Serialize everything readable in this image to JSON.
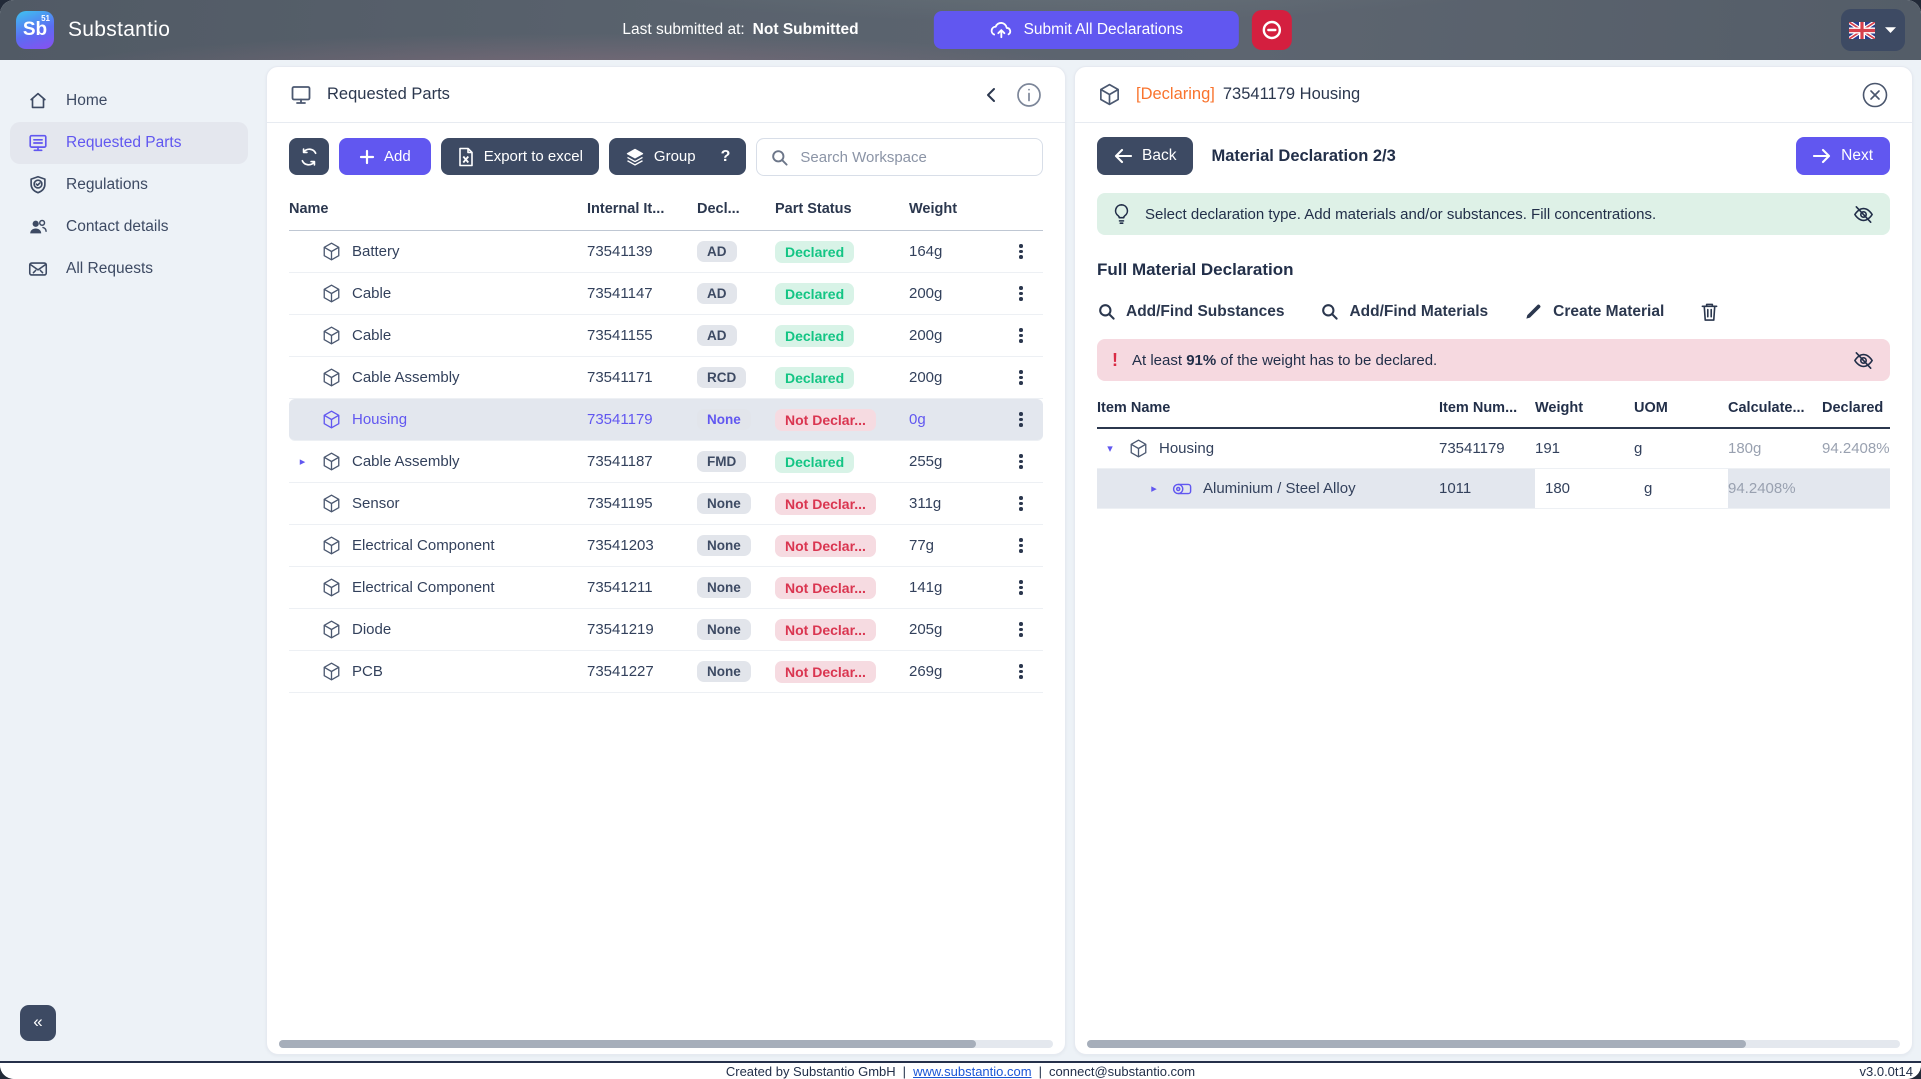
{
  "colors": {
    "accent": "#6157f0",
    "dark_button": "#3d4a63",
    "danger": "#d41f3f",
    "declared_green": "#13c584",
    "not_declared_red": "#da3550",
    "declaring_orange": "#f9742e"
  },
  "icons": [
    "home-icon",
    "monitor-icon",
    "shield-check-icon",
    "users-icon",
    "mail-icon",
    "cube-icon",
    "refresh-icon",
    "plus-icon",
    "excel-file-icon",
    "layers-icon",
    "search-icon",
    "chevron-left-icon",
    "info-icon",
    "kebab-menu-icon",
    "cloud-upload-icon",
    "minus-circle-icon",
    "uk-flag-icon",
    "caret-down-icon",
    "close-circle-icon",
    "arrow-left-icon",
    "arrow-right-icon",
    "bulb-icon",
    "eye-off-icon",
    "pencil-icon",
    "trash-icon",
    "material-icon",
    "collapse-icon"
  ],
  "topbar": {
    "logo_text": "Sb",
    "logo_sup": "51",
    "brand": "Substantio",
    "last_submitted_label": "Last submitted at:",
    "last_submitted_value": "Not Submitted",
    "submit_label": "Submit All Declarations"
  },
  "sidebar": {
    "items": [
      {
        "label": "Home"
      },
      {
        "label": "Requested Parts"
      },
      {
        "label": "Regulations"
      },
      {
        "label": "Contact details"
      },
      {
        "label": "All Requests"
      }
    ],
    "collapse_label": "«"
  },
  "parts_panel": {
    "title": "Requested Parts",
    "toolbar": {
      "add": "Add",
      "export": "Export to excel",
      "group": "Group",
      "help": "?",
      "search_placeholder": "Search Workspace"
    },
    "table": {
      "columns": [
        "Name",
        "Internal It...",
        "Decl...",
        "Part Status",
        "Weight"
      ],
      "rows": [
        {
          "name": "Battery",
          "internal": "73541139",
          "decl": "AD",
          "status": "Declared",
          "ok": true,
          "weight": "164g",
          "selected": false,
          "expandable": false
        },
        {
          "name": "Cable",
          "internal": "73541147",
          "decl": "AD",
          "status": "Declared",
          "ok": true,
          "weight": "200g",
          "selected": false,
          "expandable": false
        },
        {
          "name": "Cable",
          "internal": "73541155",
          "decl": "AD",
          "status": "Declared",
          "ok": true,
          "weight": "200g",
          "selected": false,
          "expandable": false
        },
        {
          "name": "Cable Assembly",
          "internal": "73541171",
          "decl": "RCD",
          "status": "Declared",
          "ok": true,
          "weight": "200g",
          "selected": false,
          "expandable": false
        },
        {
          "name": "Housing",
          "internal": "73541179",
          "decl": "None",
          "status": "Not Declar...",
          "ok": false,
          "weight": "0g",
          "selected": true,
          "expandable": false
        },
        {
          "name": "Cable Assembly",
          "internal": "73541187",
          "decl": "FMD",
          "status": "Declared",
          "ok": true,
          "weight": "255g",
          "selected": false,
          "expandable": true
        },
        {
          "name": "Sensor",
          "internal": "73541195",
          "decl": "None",
          "status": "Not Declar...",
          "ok": false,
          "weight": "311g",
          "selected": false,
          "expandable": false
        },
        {
          "name": "Electrical Component",
          "internal": "73541203",
          "decl": "None",
          "status": "Not Declar...",
          "ok": false,
          "weight": "77g",
          "selected": false,
          "expandable": false
        },
        {
          "name": "Electrical Component",
          "internal": "73541211",
          "decl": "None",
          "status": "Not Declar...",
          "ok": false,
          "weight": "141g",
          "selected": false,
          "expandable": false
        },
        {
          "name": "Diode",
          "internal": "73541219",
          "decl": "None",
          "status": "Not Declar...",
          "ok": false,
          "weight": "205g",
          "selected": false,
          "expandable": false
        },
        {
          "name": "PCB",
          "internal": "73541227",
          "decl": "None",
          "status": "Not Declar...",
          "ok": false,
          "weight": "269g",
          "selected": false,
          "expandable": false
        }
      ]
    }
  },
  "declaration_panel": {
    "title_tag": "[Declaring]",
    "title": "73541179 Housing",
    "back_label": "Back",
    "step_label": "Material Declaration 2/3",
    "next_label": "Next",
    "hint": "Select declaration type. Add materials and/or substances. Fill concentrations.",
    "section_title": "Full Material Declaration",
    "actions": {
      "substances": "Add/Find Substances",
      "materials": "Add/Find Materials",
      "create": "Create Material"
    },
    "warning": {
      "prefix": "At least ",
      "bold": "91%",
      "suffix": " of the weight has to be declared."
    },
    "table": {
      "columns": [
        "Item Name",
        "Item Num...",
        "Weight",
        "UOM",
        "Calculate...",
        "Declared"
      ],
      "rows": [
        {
          "level": 0,
          "caret": "down",
          "icon": "cube-icon",
          "name": "Housing",
          "num": "73541179",
          "weight": "191",
          "uom": "g",
          "calculated": "180g",
          "declared": "94.2408%",
          "selected": false,
          "editable": false
        },
        {
          "level": 1,
          "caret": "right",
          "icon": "material-icon",
          "name": "Aluminium / Steel Alloy",
          "num": "1011",
          "weight": "180",
          "uom": "g",
          "calculated": "94.2408%",
          "declared": "",
          "selected": true,
          "editable": true
        }
      ]
    }
  },
  "footer": {
    "created": "Created by Substantio GmbH",
    "sep1": "|",
    "site": "www.substantio.com",
    "sep2": "|",
    "email": "connect@substantio.com",
    "version": "v3.0.0t14"
  }
}
